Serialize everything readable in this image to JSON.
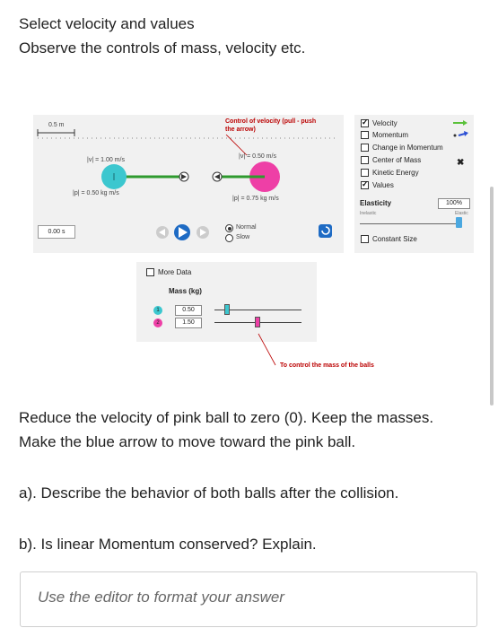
{
  "intro": {
    "line1": "Select velocity and values",
    "line2": "Observe the controls of mass, velocity etc."
  },
  "sim": {
    "scale_label": "0.5 m",
    "annotation_velocity": "Control of velocity (pull - push",
    "annotation_velocity2": "the arrow)",
    "ball1_velocity": "|v| = 1.00 m/s",
    "ball1_momentum": "|p| = 0.50 kg m/s",
    "ball2_velocity": "|v| = 0.50 m/s",
    "ball2_momentum": "|p| = 0.75 kg m/s",
    "timer": "0.00 s",
    "speed_normal": "Normal",
    "speed_slow": "Slow",
    "speed_selected": "Normal",
    "ball1_color": "#3cc7cf",
    "ball2_color": "#ee3fa6"
  },
  "options": {
    "velocity": "Velocity",
    "momentum": "Momentum",
    "change_momentum": "Change in Momentum",
    "center_mass": "Center of Mass",
    "kinetic_energy": "Kinetic Energy",
    "values": "Values",
    "elasticity_label": "Elasticity",
    "elasticity_value": "100%",
    "inelastic": "Inelastic",
    "elastic": "Elastic",
    "elasticity_level": 1.0,
    "constant_size": "Constant Size",
    "checked": {
      "velocity": true,
      "momentum": false,
      "change_momentum": false,
      "center_mass": false,
      "kinetic_energy": false,
      "values": true,
      "constant_size": false
    }
  },
  "mass": {
    "more_data": "More Data",
    "header": "Mass (kg)",
    "ball1_label": "1",
    "ball2_label": "2",
    "ball1_value": "0.50",
    "ball2_value": "1.50",
    "annotation": "To control the mass of the balls"
  },
  "questions": {
    "instruction1": "Reduce the velocity of pink ball to zero (0). Keep the masses.",
    "instruction2": "Make the blue arrow to move toward the pink ball.",
    "a": "a). Describe the behavior of both balls after the collision.",
    "b": "b). Is linear Momentum conserved? Explain."
  },
  "answer": {
    "placeholder": "Use the editor to format your answer"
  }
}
